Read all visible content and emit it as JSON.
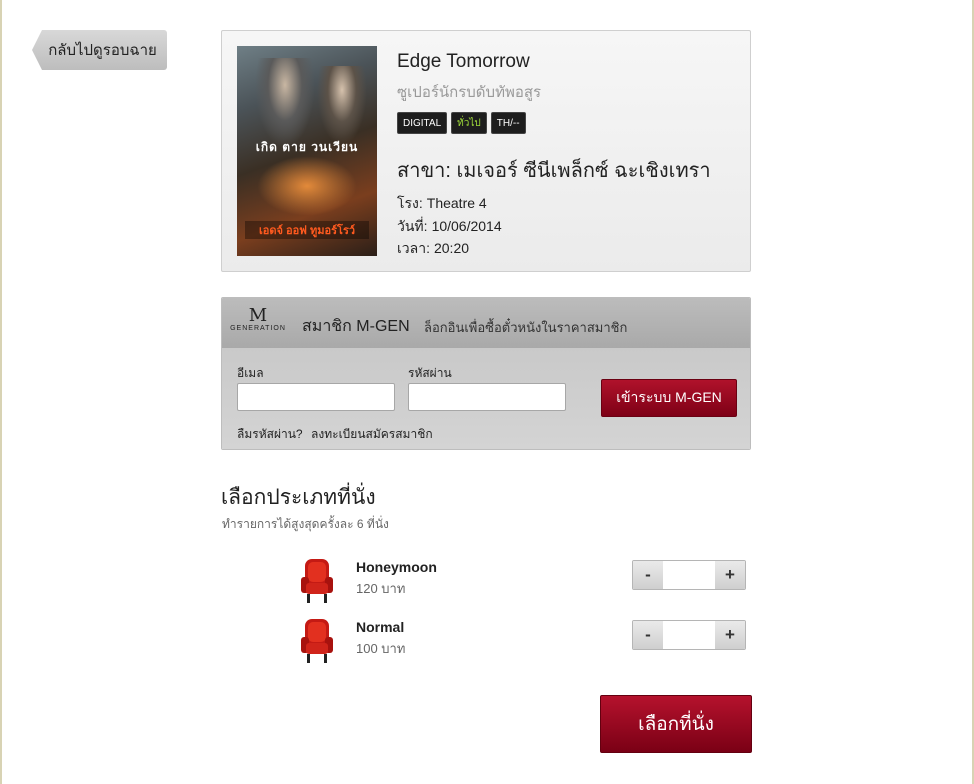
{
  "back_button": {
    "label": "กลับไปดูรอบฉาย"
  },
  "movie": {
    "poster": {
      "tagline": "เกิด ตาย วนเวียน",
      "title_art": "เอดจ์ ออฟ ทูมอร์โรว์"
    },
    "title": "Edge Tomorrow",
    "subtitle": "ซูเปอร์นักรบดับทัพอสูร",
    "badges": [
      "DIGITAL",
      "ทั่วไป",
      "TH/--"
    ],
    "branch": "สาขา: เมเจอร์ ซีนีเพล็กซ์ ฉะเชิงเทรา",
    "theatre_label": "โรง:",
    "theatre_value": "Theatre 4",
    "date_label": "วันที่:",
    "date_value": "10/06/2014",
    "time_label": "เวลา:",
    "time_value": "20:20"
  },
  "login": {
    "logo_mark": "M",
    "logo_text": "GENERATION",
    "title": "สมาชิก M-GEN",
    "description": "ล็อกอินเพื่อซื้อตั๋วหนังในราคาสมาชิก",
    "email_label": "อีเมล",
    "email_value": "",
    "password_label": "รหัสผ่าน",
    "password_value": "",
    "submit_label": "เข้าระบบ M-GEN",
    "forgot_label": "ลืมรหัสผ่าน?",
    "register_label": "ลงทะเบียนสมัครสมาชิก"
  },
  "seats": {
    "heading": "เลือกประเภทที่นั่ง",
    "note": "ทำรายการได้สูงสุดครั้งละ 6 ที่นั่ง",
    "types": [
      {
        "name": "Honeymoon",
        "price": "120 บาท",
        "quantity": "",
        "icon": "armchair-icon"
      },
      {
        "name": "Normal",
        "price": "100 บาท",
        "quantity": "",
        "icon": "armchair-icon"
      }
    ],
    "minus_label": "-",
    "plus_label": "+",
    "select_button_label": "เลือกที่นั่ง"
  },
  "colors": {
    "accent_red": "#9b0d24",
    "panel_gray": "#bcbcbc",
    "frame_tan": "#d8d3b4"
  }
}
